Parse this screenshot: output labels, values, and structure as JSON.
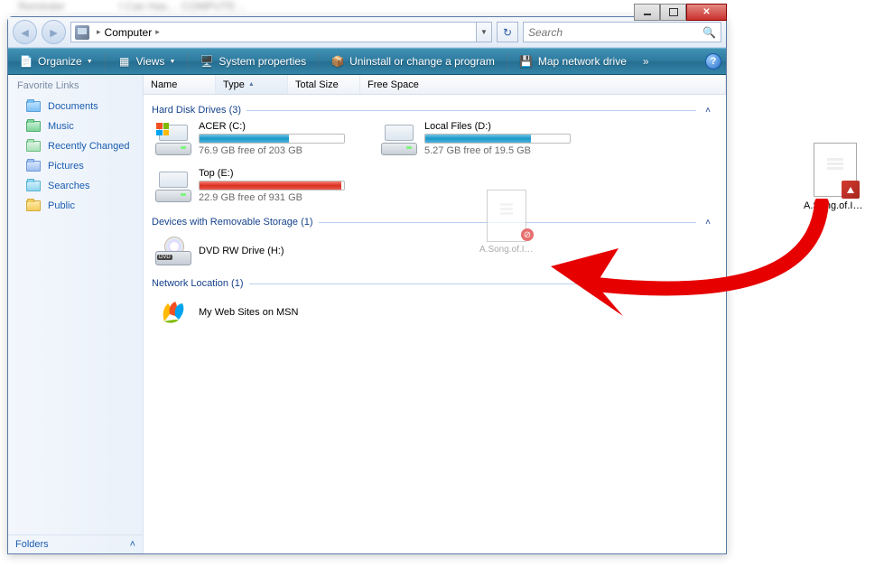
{
  "breadcrumb": {
    "root_arrow": "▸",
    "location": "Computer",
    "arrow": "▸"
  },
  "search": {
    "placeholder": "Search"
  },
  "toolbar": {
    "organize": "Organize",
    "views": "Views",
    "sysprops": "System properties",
    "uninstall": "Uninstall or change a program",
    "mapdrive": "Map network drive",
    "more": "»"
  },
  "sidebar": {
    "header": "Favorite Links",
    "links": [
      {
        "label": "Documents"
      },
      {
        "label": "Music"
      },
      {
        "label": "Recently Changed"
      },
      {
        "label": "Pictures"
      },
      {
        "label": "Searches"
      },
      {
        "label": "Public"
      }
    ],
    "folders": "Folders"
  },
  "columns": {
    "name": "Name",
    "type": "Type",
    "total": "Total Size",
    "free": "Free Space"
  },
  "groups": {
    "hdd": {
      "title": "Hard Disk Drives (3)"
    },
    "removable": {
      "title": "Devices with Removable Storage (1)"
    },
    "network": {
      "title": "Network Location (1)"
    }
  },
  "drives": {
    "c": {
      "name": "ACER (C:)",
      "free": "76.9 GB free of 203 GB",
      "fillPct": "62%"
    },
    "d": {
      "name": "Local Files (D:)",
      "free": "5.27 GB free of 19.5 GB",
      "fillPct": "73%"
    },
    "e": {
      "name": "Top (E:)",
      "free": "22.9 GB free of 931 GB",
      "fillPct": "98%"
    },
    "dvd": {
      "name": "DVD RW Drive (H:)"
    },
    "msn": {
      "name": "My Web Sites on MSN"
    }
  },
  "ghost": {
    "label": "A.Song.of.Ic…"
  },
  "desktop": {
    "label": "A.Song.of.Ic…"
  }
}
